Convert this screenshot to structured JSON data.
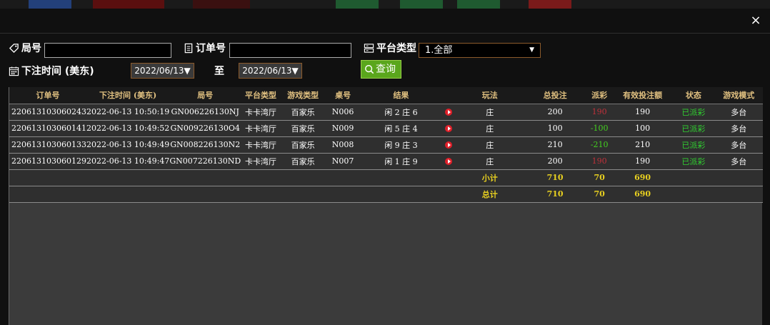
{
  "dialog": {
    "close_label": "×"
  },
  "filters": {
    "round_label": "局号",
    "order_label": "订单号",
    "platform_label": "平台类型",
    "platform_value": "1.全部",
    "bet_time_label": "下注时间 (美东)",
    "date_from": "2022/06/13▼",
    "to_label": "至",
    "date_to": "2022/06/13▼",
    "query_label": "查询"
  },
  "table": {
    "headers": [
      "订单号",
      "下注时间 (美东)",
      "局号",
      "平台类型",
      "游戏类型",
      "桌号",
      "结果",
      "",
      "玩法",
      "总投注",
      "派彩",
      "有效投注额",
      "状态",
      "游戏模式"
    ],
    "rows": [
      {
        "order": "220613103060243",
        "time": "2022-06-13 10:50:19",
        "round": "GN006226130NJ",
        "platform": "卡卡湾厅",
        "game": "百家乐",
        "table": "N006",
        "result": "闲 2 庄 6",
        "play": "庄",
        "bet": "200",
        "payout": "190",
        "payout_color": "red",
        "valid": "190",
        "status": "已派彩",
        "mode": "多台"
      },
      {
        "order": "220613103060141",
        "time": "2022-06-13 10:49:52",
        "round": "GN009226130O4",
        "platform": "卡卡湾厅",
        "game": "百家乐",
        "table": "N009",
        "result": "闲 5 庄 4",
        "play": "庄",
        "bet": "100",
        "payout": "-100",
        "payout_color": "green",
        "valid": "100",
        "status": "已派彩",
        "mode": "多台"
      },
      {
        "order": "220613103060133",
        "time": "2022-06-13 10:49:49",
        "round": "GN008226130N2",
        "platform": "卡卡湾厅",
        "game": "百家乐",
        "table": "N008",
        "result": "闲 9 庄 3",
        "play": "庄",
        "bet": "210",
        "payout": "-210",
        "payout_color": "green",
        "valid": "210",
        "status": "已派彩",
        "mode": "多台"
      },
      {
        "order": "220613103060129",
        "time": "2022-06-13 10:49:47",
        "round": "GN007226130ND",
        "platform": "卡卡湾厅",
        "game": "百家乐",
        "table": "N007",
        "result": "闲 1 庄 9",
        "play": "庄",
        "bet": "200",
        "payout": "190",
        "payout_color": "red",
        "valid": "190",
        "status": "已派彩",
        "mode": "多台"
      }
    ],
    "subtotal": {
      "label": "小计",
      "bet": "710",
      "payout": "70",
      "valid": "690"
    },
    "total": {
      "label": "总计",
      "bet": "710",
      "payout": "70",
      "valid": "690"
    }
  },
  "icons": {
    "tag": "tag-icon",
    "receipt": "receipt-icon",
    "server": "server-icon",
    "calendar": "calendar-icon",
    "search": "search-icon",
    "play": "play-icon"
  }
}
